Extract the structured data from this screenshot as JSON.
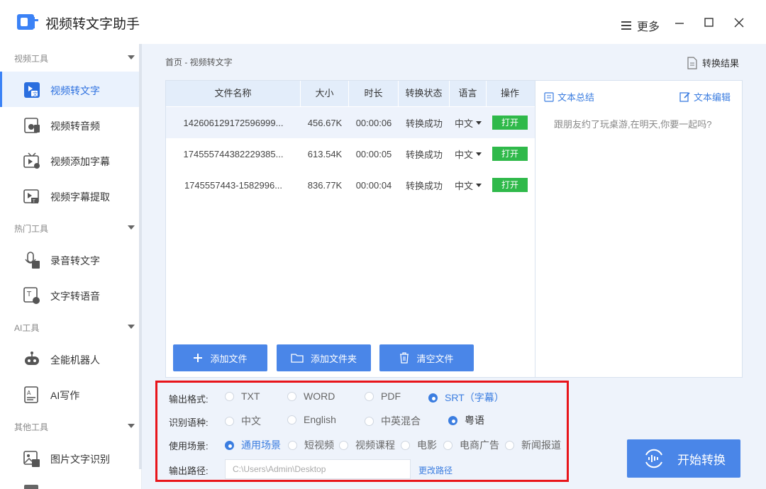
{
  "app": {
    "title": "视频转文字助手",
    "more_label": "更多"
  },
  "sidebar": {
    "groups": [
      {
        "title": "视频工具"
      },
      {
        "title": "热门工具"
      },
      {
        "title": "AI工具"
      },
      {
        "title": "其他工具"
      }
    ],
    "items": [
      {
        "label": "视频转文字",
        "icon": "video-to-text-icon",
        "active": true
      },
      {
        "label": "视频转音频",
        "icon": "video-to-audio-icon"
      },
      {
        "label": "视频添加字幕",
        "icon": "add-subtitle-icon"
      },
      {
        "label": "视频字幕提取",
        "icon": "extract-subtitle-icon"
      },
      {
        "label": "录音转文字",
        "icon": "audio-to-text-icon"
      },
      {
        "label": "文字转语音",
        "icon": "text-to-speech-icon"
      },
      {
        "label": "全能机器人",
        "icon": "robot-icon"
      },
      {
        "label": "AI写作",
        "icon": "ai-writing-icon"
      },
      {
        "label": "图片文字识别",
        "icon": "image-ocr-icon"
      }
    ]
  },
  "breadcrumb": "首页 - 视频转文字",
  "result_button": "转换结果",
  "table": {
    "headers": [
      "文件名称",
      "大小",
      "时长",
      "转换状态",
      "语言",
      "操作"
    ],
    "rows": [
      {
        "name": "142606129172596999...",
        "size": "456.67K",
        "duration": "00:00:06",
        "status": "转换成功",
        "lang": "中文",
        "action": "打开"
      },
      {
        "name": "174555744382229385...",
        "size": "613.54K",
        "duration": "00:00:05",
        "status": "转换成功",
        "lang": "中文",
        "action": "打开"
      },
      {
        "name": "1745557443-1582996...",
        "size": "836.77K",
        "duration": "00:00:04",
        "status": "转换成功",
        "lang": "中文",
        "action": "打开"
      }
    ]
  },
  "buttons": {
    "add_file": "添加文件",
    "add_folder": "添加文件夹",
    "clear_files": "清空文件",
    "start": "开始转换"
  },
  "text_panel": {
    "summary_tab": "文本总结",
    "edit_tab": "文本编辑",
    "content": "跟朋友约了玩桌游,在明天,你要一起吗?"
  },
  "options": {
    "format_label": "输出格式:",
    "formats": [
      "TXT",
      "WORD",
      "PDF",
      "SRT（字幕）"
    ],
    "format_selected": 3,
    "language_label": "识别语种:",
    "languages": [
      "中文",
      "English",
      "中英混合",
      "粤语"
    ],
    "language_selected": 3,
    "scene_label": "使用场景:",
    "scenes": [
      "通用场景",
      "短视频",
      "视频课程",
      "电影",
      "电商广告",
      "新闻报道"
    ],
    "scene_selected": 0,
    "path_label": "输出路径:",
    "path_value": "C:\\Users\\Admin\\Desktop",
    "path_change": "更改路径"
  },
  "colors": {
    "accent": "#4a86e8",
    "open_button": "#2fb94a",
    "highlight_border": "#e8141a"
  }
}
